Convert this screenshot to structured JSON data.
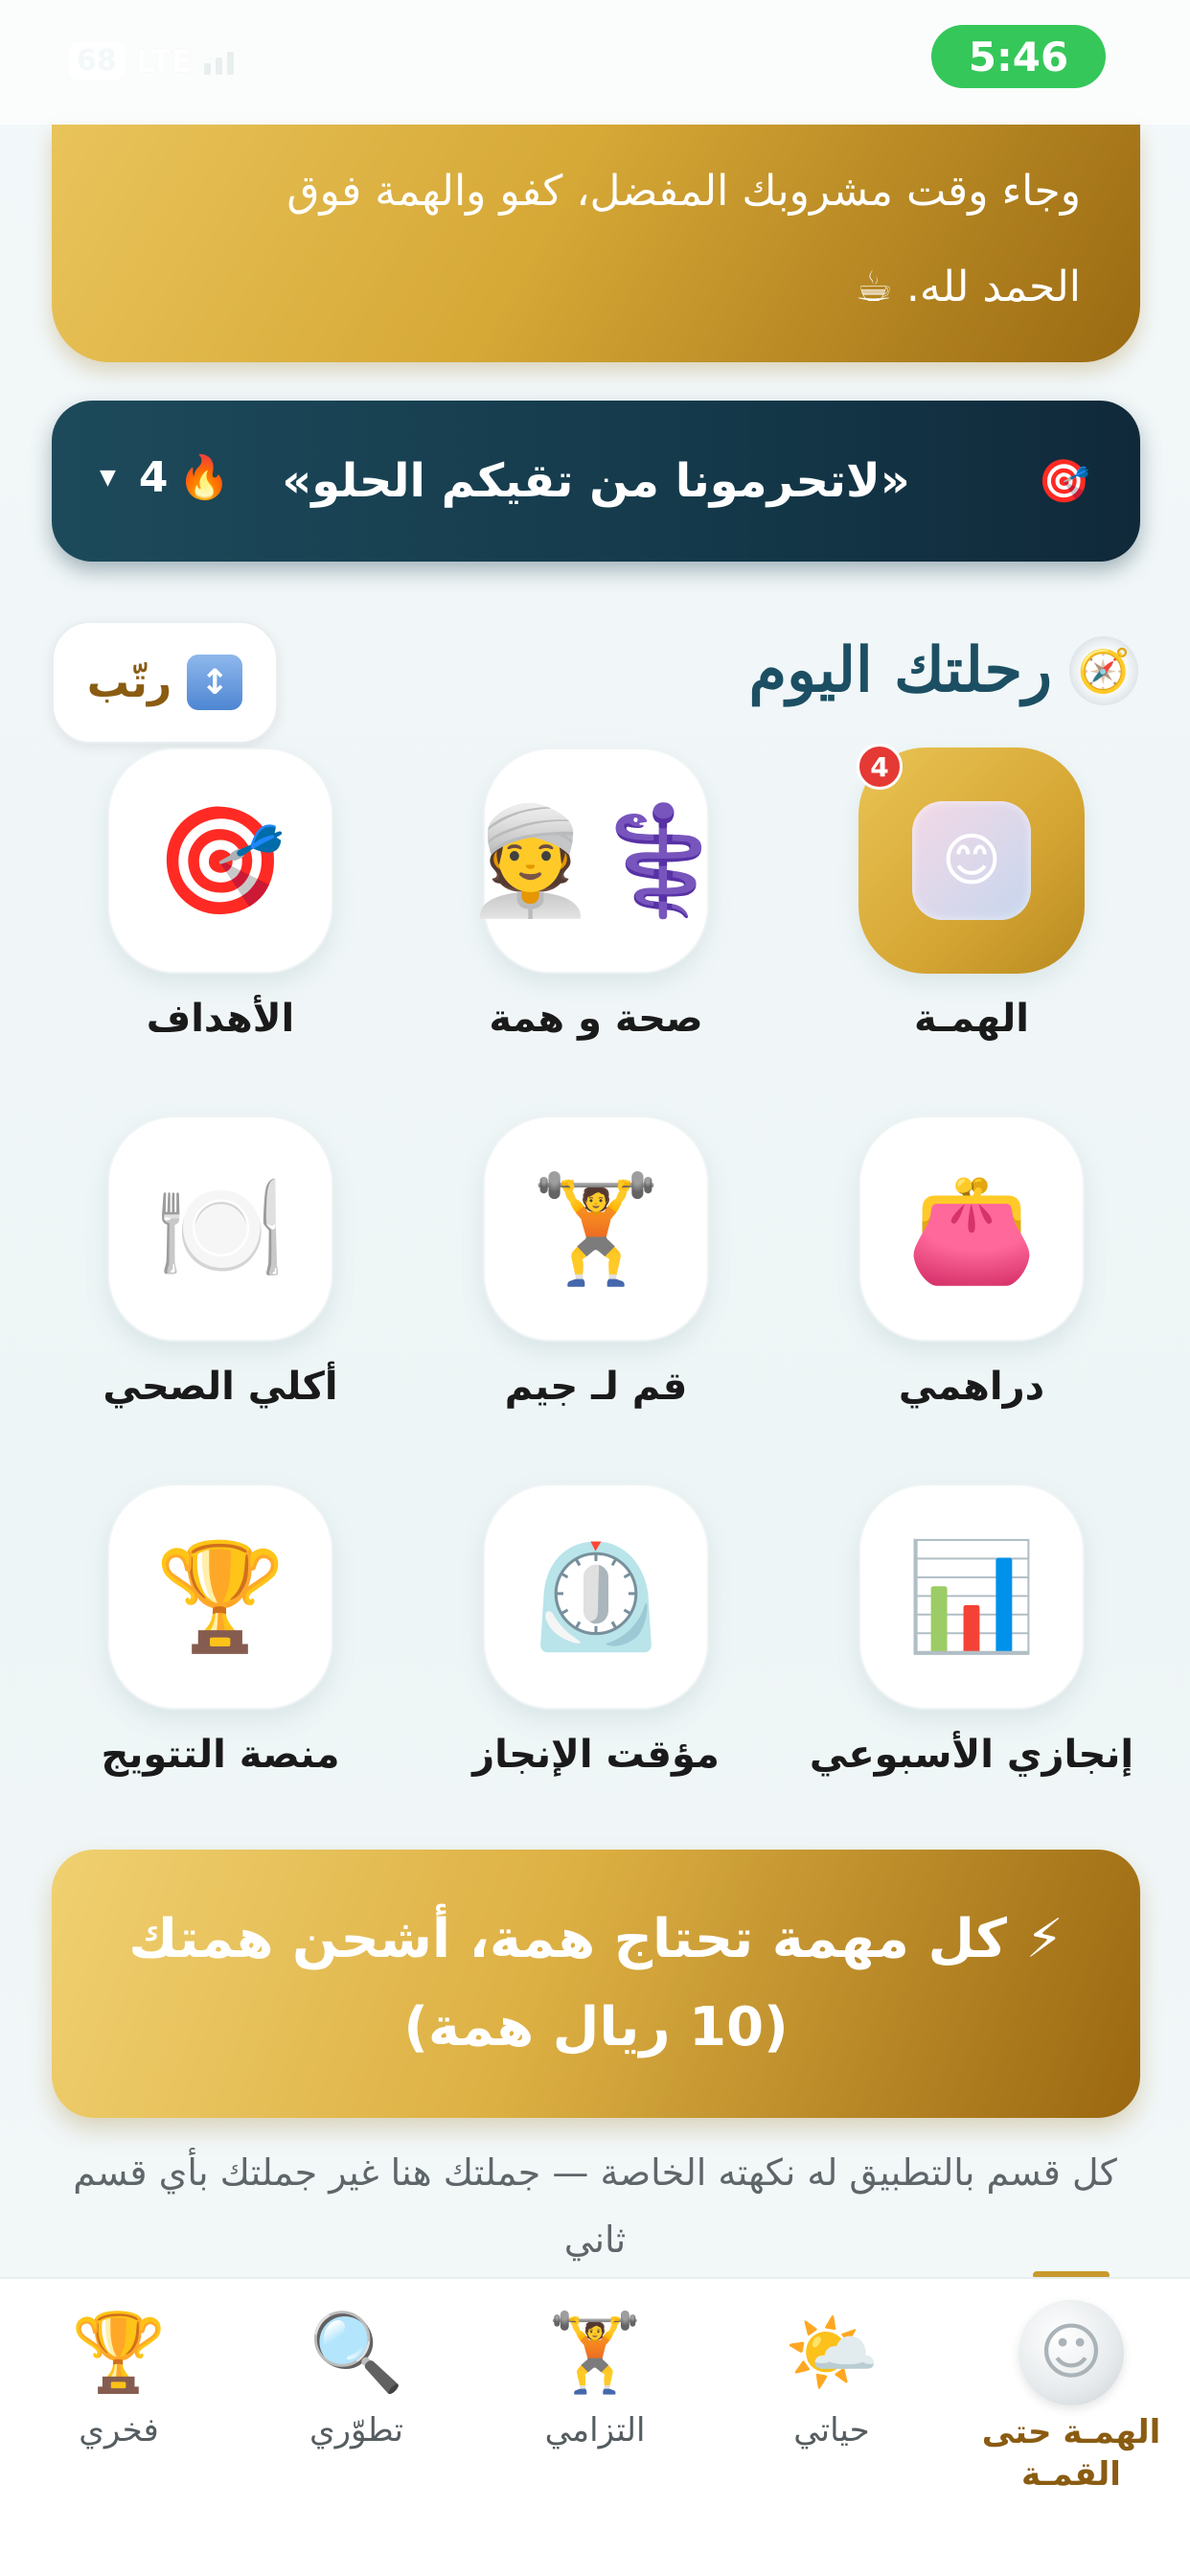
{
  "status_bar": {
    "battery": "68",
    "network": "LTE",
    "time": "5:46"
  },
  "gold_card": {
    "line1": "وجاء وقت مشروبك المفضل، كفو والهمة فوق",
    "line2": "الحمد لله. ☕"
  },
  "quote_banner": {
    "target_icon": "🎯",
    "quote": "«لاتحرمونا من تقيكم الحلو»",
    "streak_count": "4",
    "streak_icon": "🔥",
    "chevron": "▼"
  },
  "section": {
    "compass_icon": "🧭",
    "title": "رحلتك اليوم",
    "sort_label": "رتّب",
    "sort_icon": "↕"
  },
  "tiles": [
    {
      "label": "الهمـة",
      "icon": "😊",
      "badge": "4"
    },
    {
      "label": "صحة و همة",
      "icon": "👳‍⚕️"
    },
    {
      "label": "الأهداف",
      "icon": "🎯"
    },
    {
      "label": "دراهمي",
      "icon": "👛"
    },
    {
      "label": "قم لـ جيم",
      "icon": "🏋️"
    },
    {
      "label": "أكلي الصحي",
      "icon": "🍽️"
    },
    {
      "label": "إنجازي الأسبوعي",
      "icon": "📊"
    },
    {
      "label": "مؤقت الإنجاز",
      "icon": "⏲️"
    },
    {
      "label": "منصة التتويج",
      "icon": "🏆"
    }
  ],
  "charge_banner": {
    "line1": "⚡ كل مهمة تحتاج همة، أشحن همتك",
    "line2": "(10 ريال همة)"
  },
  "note": "كل قسم بالتطبيق له نكهته الخاصة — جملتك هنا غير جملتك بأي قسم ثاني",
  "bottom_nav": [
    {
      "label": "الهمـة حتى القمـة",
      "icon": "☺",
      "active": true
    },
    {
      "label": "حياتي",
      "icon": "🌤️"
    },
    {
      "label": "التزامي",
      "icon": "🏋️"
    },
    {
      "label": "تطوّري",
      "icon": "🔍"
    },
    {
      "label": "فخري",
      "icon": "🏆"
    }
  ]
}
